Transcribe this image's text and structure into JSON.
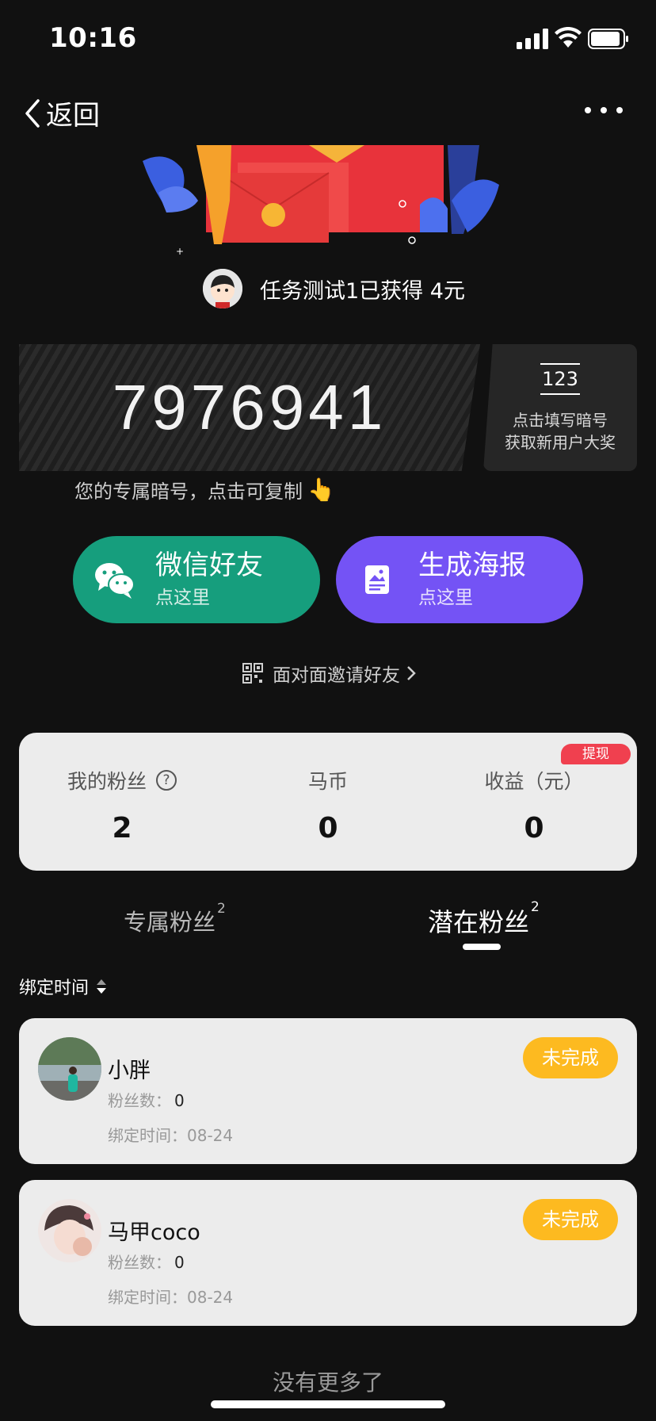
{
  "status_bar": {
    "time": "10:16"
  },
  "nav": {
    "back_label": "返回"
  },
  "reward": {
    "text": "任务测试1已获得 4元"
  },
  "code": {
    "number": "7976941",
    "copy_hint": "您的专属暗号，点击可复制",
    "fill_box": "123",
    "fill_tip_1": "点击填写暗号",
    "fill_tip_2": "获取新用户大奖"
  },
  "share": {
    "wechat": {
      "title": "微信好友",
      "sub": "点这里"
    },
    "poster": {
      "title": "生成海报",
      "sub": "点这里"
    },
    "invite_face": "面对面邀请好友"
  },
  "stats": {
    "fans_label": "我的粉丝",
    "fans_value": "2",
    "coins_label": "马币",
    "coins_value": "0",
    "earnings_label": "收益（元）",
    "earnings_value": "0",
    "withdraw": "提现"
  },
  "tabs": {
    "exclusive": {
      "label": "专属粉丝",
      "count": "2"
    },
    "potential": {
      "label": "潜在粉丝",
      "count": "2"
    }
  },
  "sort": {
    "label": "绑定时间"
  },
  "fans": [
    {
      "name": "小胖",
      "fans_label": "粉丝数：",
      "fans_count": "0",
      "bind_time": "绑定时间：08-24",
      "status": "未完成"
    },
    {
      "name": "马甲coco",
      "fans_label": "粉丝数：",
      "fans_count": "0",
      "bind_time": "绑定时间：08-24",
      "status": "未完成"
    }
  ],
  "footer": {
    "no_more": "没有更多了"
  },
  "colors": {
    "wechat_green": "#169e7d",
    "poster_purple": "#7453f5",
    "pending_yellow": "#fdba20",
    "badge_red": "#f0404f"
  }
}
